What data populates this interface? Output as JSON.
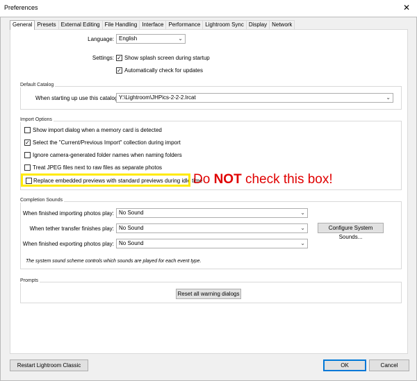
{
  "window": {
    "title": "Preferences",
    "close_glyph": "✕"
  },
  "tabs": [
    "General",
    "Presets",
    "External Editing",
    "File Handling",
    "Interface",
    "Performance",
    "Lightroom Sync",
    "Display",
    "Network"
  ],
  "general": {
    "language_label": "Language:",
    "language_value": "English",
    "settings_label": "Settings:",
    "splash_label": "Show splash screen during startup",
    "updates_label": "Automatically check for updates"
  },
  "catalog": {
    "group_title": "Default Catalog",
    "label": "When starting up use this catalog:",
    "value": "Y:\\Lightroom\\JHPics-2-2-2.lrcat"
  },
  "import": {
    "group_title": "Import Options",
    "options": [
      {
        "label": "Show import dialog when a memory card is detected",
        "checked": false
      },
      {
        "label": "Select the \"Current/Previous Import\" collection during import",
        "checked": true
      },
      {
        "label": "Ignore camera-generated folder names when naming folders",
        "checked": false
      },
      {
        "label": "Treat JPEG files next to raw files as separate photos",
        "checked": false
      },
      {
        "label": "Replace embedded previews with standard previews during idle time",
        "checked": false
      }
    ],
    "annotation_pre": "Do ",
    "annotation_bold": "NOT",
    "annotation_post": " check this box!"
  },
  "sounds": {
    "group_title": "Completion Sounds",
    "import_label": "When finished importing photos play:",
    "import_value": "No Sound",
    "tether_label": "When tether transfer finishes play:",
    "tether_value": "No Sound",
    "export_label": "When finished exporting photos play:",
    "export_value": "No Sound",
    "configure_button": "Configure System Sounds...",
    "info": "The system sound scheme controls which sounds are played for each event type."
  },
  "prompts": {
    "group_title": "Prompts",
    "reset_button": "Reset all warning dialogs"
  },
  "footer": {
    "restart_button": "Restart Lightroom Classic",
    "ok_button": "OK",
    "cancel_button": "Cancel"
  },
  "colors": {
    "highlight": "#ffea00",
    "annotation": "#e00000",
    "accent": "#0078d7"
  }
}
